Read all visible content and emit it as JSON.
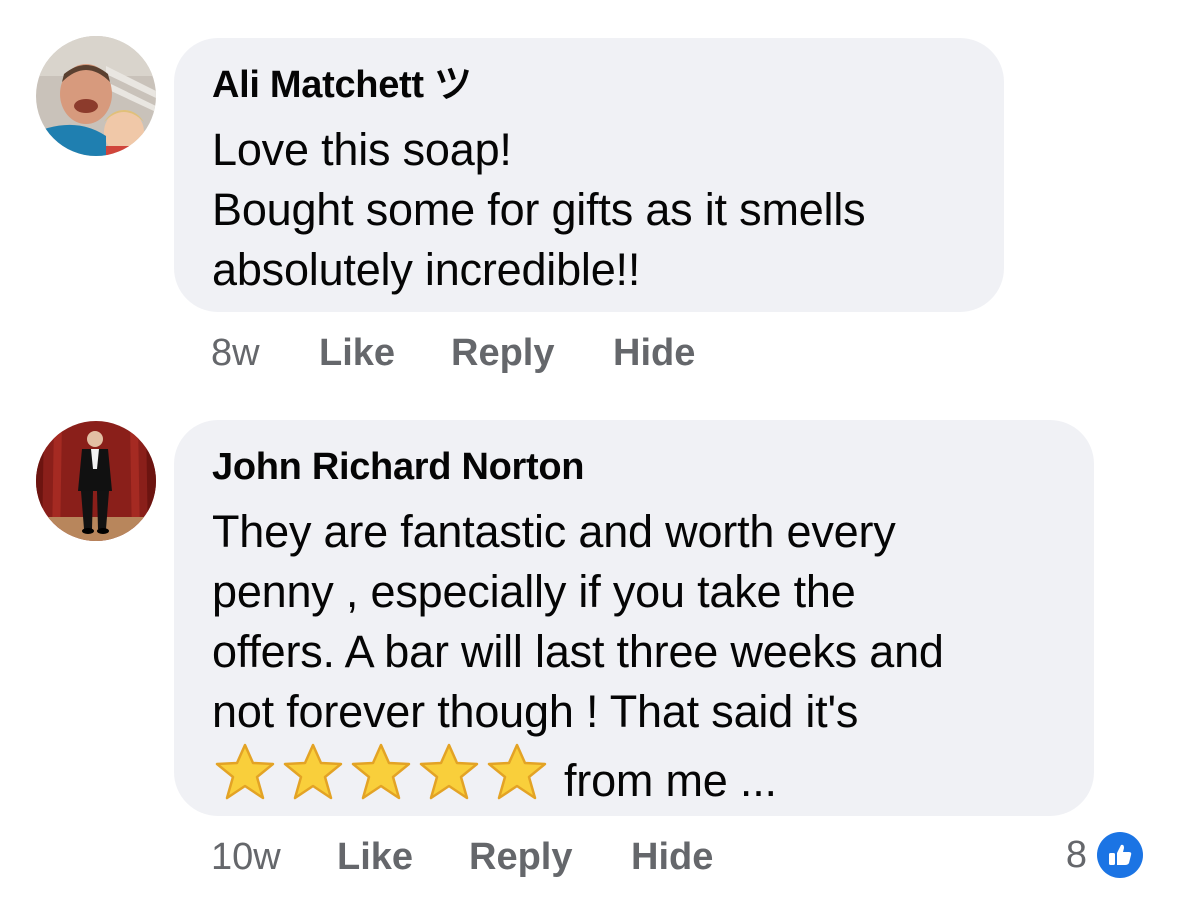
{
  "comments": [
    {
      "author": "Ali Matchett ツ",
      "lines": [
        "Love this soap!",
        "Bought some for gifts as it smells",
        "absolutely incredible!!"
      ],
      "time": "8w",
      "actions": [
        "Like",
        "Reply",
        "Hide"
      ]
    },
    {
      "author": "John Richard Norton",
      "lines": [
        "They are fantastic and worth every",
        "penny , especially if you take the",
        "offers. A bar will last three weeks and",
        "not forever though ! That said it's"
      ],
      "rating_stars": 5,
      "rating_suffix": "from me ...",
      "time": "10w",
      "actions": [
        "Like",
        "Reply",
        "Hide"
      ],
      "reaction_count": "8",
      "reaction_icon": "thumbs-up-icon"
    }
  ],
  "colors": {
    "bubble": "#f0f1f5",
    "meta_text": "#65676b",
    "like_blue": "#1b74e4",
    "star_fill": "#f9cf3b"
  }
}
